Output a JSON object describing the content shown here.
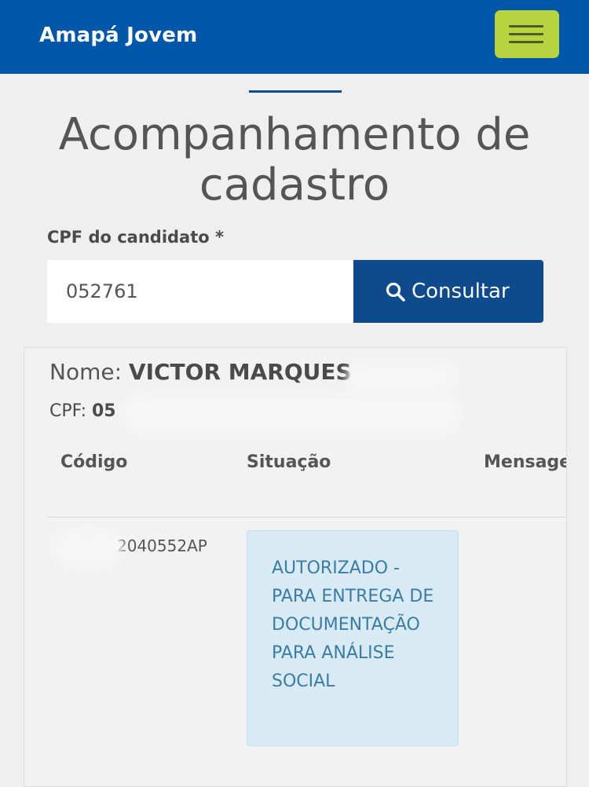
{
  "header": {
    "brand": "Amapá Jovem",
    "menu_icon": "hamburger-menu-icon",
    "brand_color": "#0057aa",
    "menu_color": "#b7d43f"
  },
  "page": {
    "title": "Acompanhamento de cadastro"
  },
  "form": {
    "cpf_label": "CPF do candidato *",
    "cpf_value": "052761",
    "search_button_label": "Consultar",
    "search_icon": "search-icon",
    "button_color": "#0f4b8c"
  },
  "result": {
    "name_label": "Nome:",
    "name_value": "VICTOR MARQUES",
    "cpf_label": "CPF:",
    "cpf_value": "05",
    "table": {
      "columns": [
        "Código",
        "Situação",
        "Mensage"
      ],
      "rows": [
        {
          "codigo": "2040552AP",
          "situacao": "AUTORIZADO - PARA ENTREGA DE DOCUMENTAÇÃO PARA ANÁLISE SOCIAL",
          "mensagem": ""
        }
      ]
    },
    "status_color": "#3a7ca5",
    "status_bg": "#d8eaf4"
  }
}
